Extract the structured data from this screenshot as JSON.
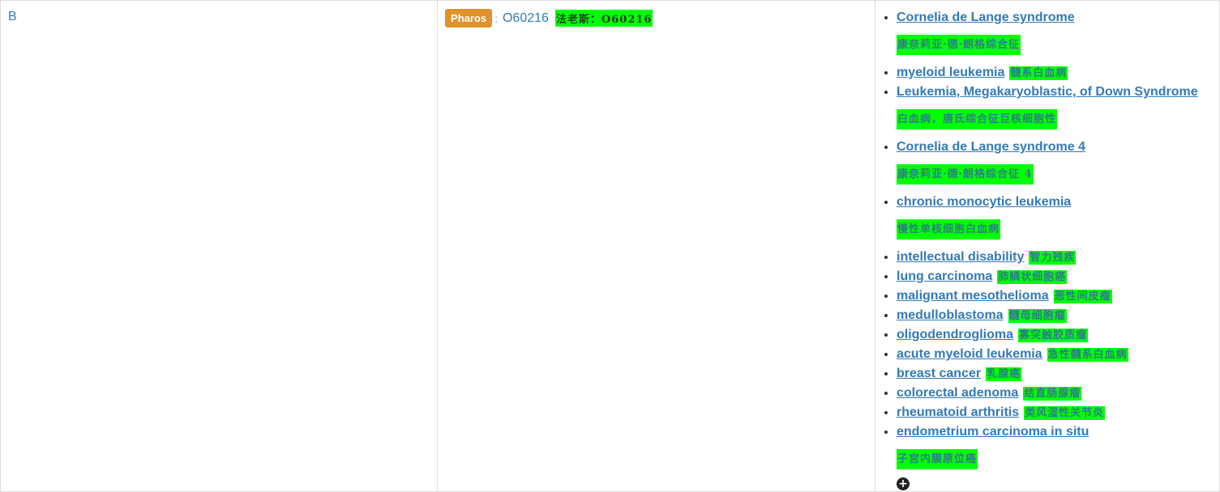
{
  "cell_a": {
    "letter": "B"
  },
  "cell_b": {
    "badge": "Pharos",
    "colon": ":",
    "id": "O60216",
    "translation": "法老斯：O60216"
  },
  "diseases": [
    {
      "name": "Cornelia de Lange syndrome",
      "translation": "康奈莉亚·德·朗格综合征"
    },
    {
      "name": "myeloid leukemia",
      "translation": "髓系白血病"
    },
    {
      "name": "Leukemia, Megakaryoblastic, of Down Syndrome",
      "translation": "白血病，唐氏综合征巨核细胞性"
    },
    {
      "name": "Cornelia de Lange syndrome 4",
      "translation": "康奈莉亚·德·朗格综合征 4"
    },
    {
      "name": "chronic monocytic leukemia",
      "translation": "慢性单核细胞白血病"
    },
    {
      "name": "intellectual disability",
      "translation": "智力残疾"
    },
    {
      "name": "lung carcinoma",
      "translation": "肺鳞状细胞癌"
    },
    {
      "name": "malignant mesothelioma",
      "translation": "恶性间皮瘤"
    },
    {
      "name": "medulloblastoma",
      "translation": "髓母细胞瘤"
    },
    {
      "name": "oligodendroglioma",
      "translation": "寡突触胶质瘤"
    },
    {
      "name": "acute myeloid leukemia",
      "translation": "急性髓系白血病"
    },
    {
      "name": "breast cancer",
      "translation": "乳腺癌"
    },
    {
      "name": "colorectal adenoma",
      "translation": "结直肠腺瘤"
    },
    {
      "name": "rheumatoid arthritis",
      "translation": "类风湿性关节炎"
    },
    {
      "name": "endometrium carcinoma in situ",
      "translation": "子宫内膜原位癌"
    }
  ],
  "more_icon": "plus-circle-icon"
}
